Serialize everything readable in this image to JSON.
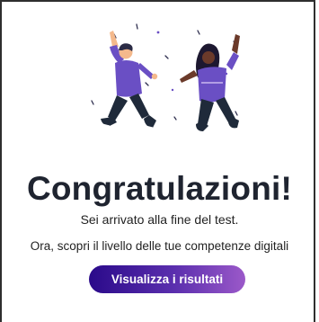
{
  "heading": "Congratulazioni!",
  "message_end": "Sei arrivato alla fine del test.",
  "message_next": "Ora, scopri il livello delle tue competenze digitali",
  "cta_label": "Visualizza i risultati",
  "illustration": {
    "icon": "two-people-jumping-celebrating-illustration"
  },
  "colors": {
    "title": "#1f2430",
    "button_start": "#2a0a8a",
    "button_end": "#9b59c9",
    "shirt_purple": "#6a4fc4",
    "pants_dark": "#1f2a3a"
  }
}
